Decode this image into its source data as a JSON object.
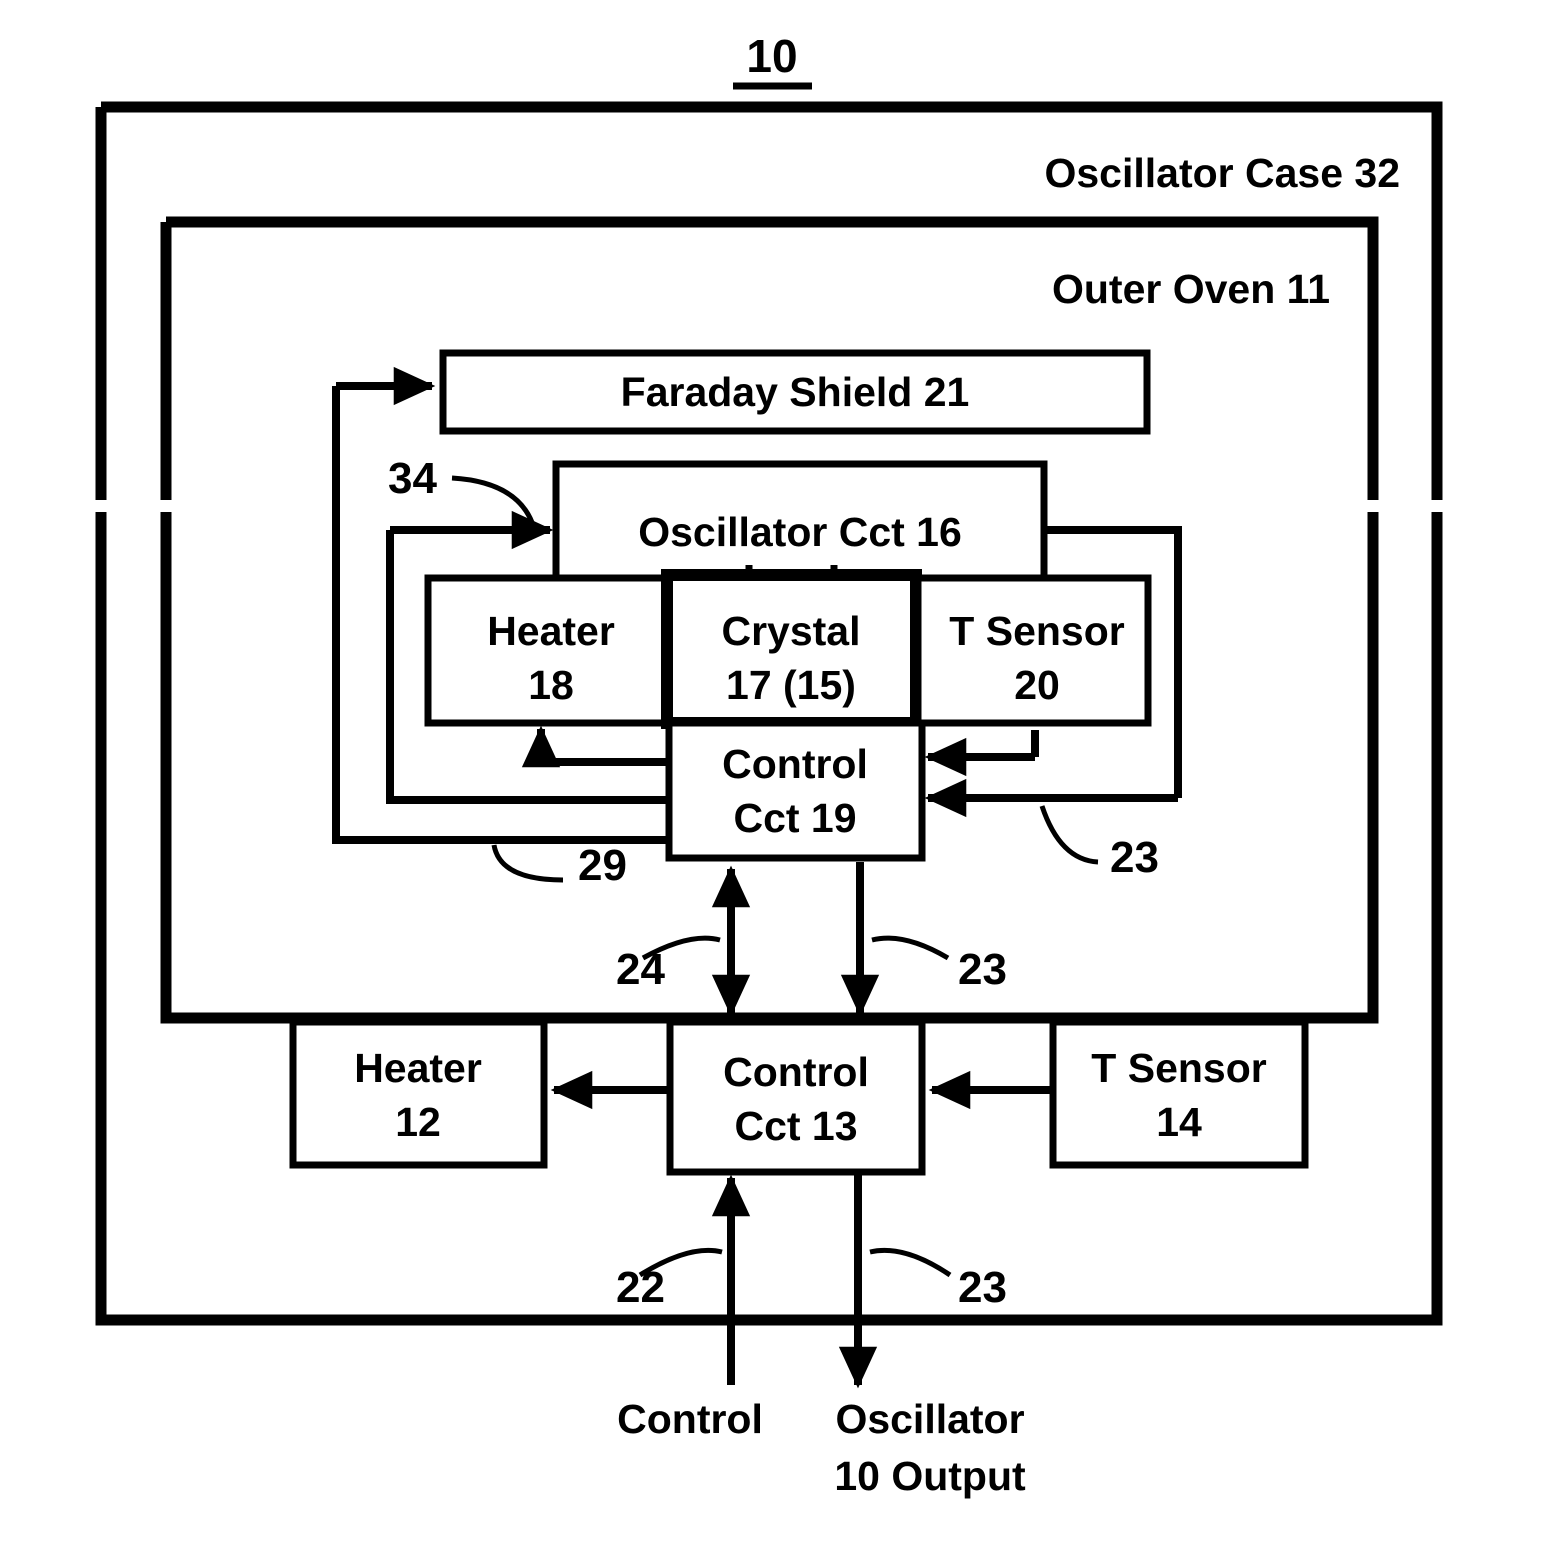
{
  "figure": {
    "number": "10",
    "underlined": true
  },
  "regions": [
    {
      "id": "oscillator-case",
      "label": "Oscillator Case 32"
    },
    {
      "id": "outer-oven",
      "label": "Outer Oven 11"
    }
  ],
  "blocks": [
    {
      "id": "faraday-shield",
      "label": "Faraday Shield 21",
      "lines": [
        "Faraday Shield 21"
      ]
    },
    {
      "id": "oscillator-cct",
      "label": "Oscillator Cct 16",
      "lines": [
        "Oscillator Cct 16"
      ]
    },
    {
      "id": "inner-heater",
      "label": "Heater 18",
      "lines": [
        "Heater",
        "18"
      ]
    },
    {
      "id": "crystal",
      "label": "Crystal 17 (15)",
      "lines": [
        "Crystal",
        "17 (15)"
      ]
    },
    {
      "id": "inner-t-sensor",
      "label": "T Sensor 20",
      "lines": [
        "T Sensor",
        "20"
      ]
    },
    {
      "id": "inner-control",
      "label": "Control Cct 19",
      "lines": [
        "Control",
        "Cct 19"
      ]
    },
    {
      "id": "outer-heater",
      "label": "Heater 12",
      "lines": [
        "Heater",
        "12"
      ]
    },
    {
      "id": "outer-control",
      "label": "Control Cct 13",
      "lines": [
        "Control",
        "Cct 13"
      ]
    },
    {
      "id": "outer-t-sensor",
      "label": "T Sensor 14",
      "lines": [
        "T Sensor",
        "14"
      ]
    }
  ],
  "reference_numerals": [
    {
      "id": "ref-34",
      "value": "34"
    },
    {
      "id": "ref-29",
      "value": "29"
    },
    {
      "id": "ref-23-inner-right",
      "value": "23"
    },
    {
      "id": "ref-24",
      "value": "24"
    },
    {
      "id": "ref-23-mid",
      "value": "23"
    },
    {
      "id": "ref-22",
      "value": "22"
    },
    {
      "id": "ref-23-bottom",
      "value": "23"
    }
  ],
  "terminals": [
    {
      "id": "control-input",
      "lines": [
        "Control"
      ]
    },
    {
      "id": "oscillator-output",
      "lines": [
        "Oscillator",
        "10 Output"
      ]
    }
  ],
  "colors": {
    "ink": "#000000",
    "paper": "#ffffff"
  }
}
